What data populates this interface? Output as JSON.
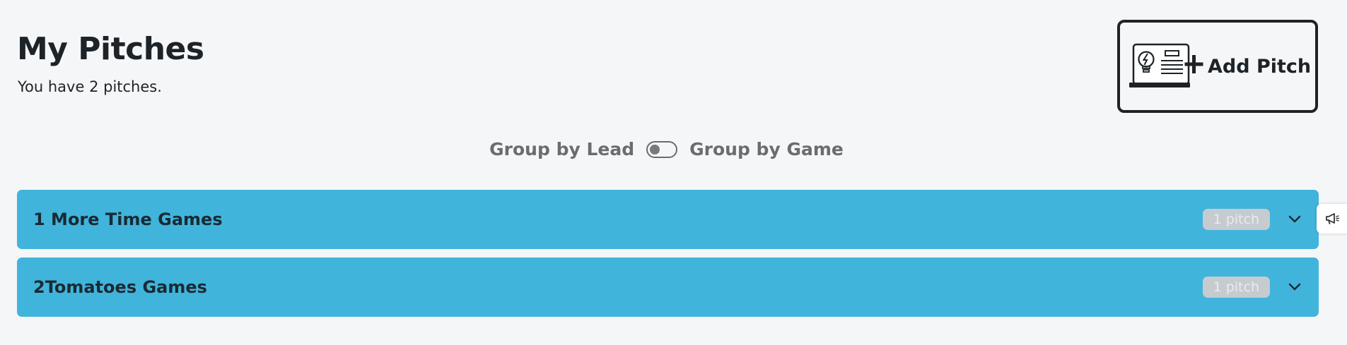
{
  "header": {
    "title": "My Pitches",
    "subtitle": "You have 2 pitches."
  },
  "add_pitch": {
    "label": "Add Pitch",
    "icon": "pitch-presentation-icon"
  },
  "grouping": {
    "left_label": "Group by Lead",
    "right_label": "Group by Game",
    "toggle_on": false
  },
  "groups": [
    {
      "name": "1 More Time Games",
      "badge": "1 pitch",
      "expanded": false
    },
    {
      "name": "2Tomatoes Games",
      "badge": "1 pitch",
      "expanded": false
    }
  ],
  "feedback": {
    "icon": "megaphone-icon"
  },
  "colors": {
    "background": "#f5f6f8",
    "group_row": "#41b4dc",
    "text_dark": "#1d2327",
    "toggle_label": "#6c6c6c",
    "badge_bg": "#c6cbcf"
  }
}
